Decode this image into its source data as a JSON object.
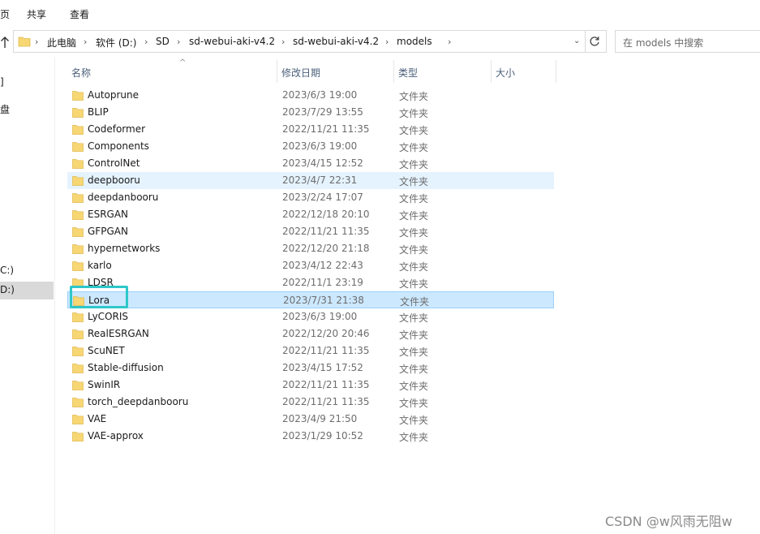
{
  "ribbon": {
    "tabs": [
      {
        "label": "页"
      },
      {
        "label": "共享"
      },
      {
        "label": "查看"
      }
    ]
  },
  "address": {
    "crumbs": [
      "此电脑",
      "软件 (D:)",
      "SD",
      "sd-webui-aki-v4.2",
      "sd-webui-aki-v4.2",
      "models"
    ],
    "search_placeholder": "在 models 中搜索"
  },
  "nav": {
    "items": [
      {
        "label": "]"
      },
      {
        "label": "盘"
      },
      {
        "label": "C:)"
      },
      {
        "label": "D:)"
      }
    ]
  },
  "columns": {
    "name": "名称",
    "date": "修改日期",
    "type": "类型",
    "size": "大小"
  },
  "files": [
    {
      "name": "Autoprune",
      "date": "2023/6/3 19:00",
      "type": "文件夹"
    },
    {
      "name": "BLIP",
      "date": "2023/7/29 13:55",
      "type": "文件夹"
    },
    {
      "name": "Codeformer",
      "date": "2022/11/21 11:35",
      "type": "文件夹"
    },
    {
      "name": "Components",
      "date": "2023/6/3 19:00",
      "type": "文件夹"
    },
    {
      "name": "ControlNet",
      "date": "2023/4/15 12:52",
      "type": "文件夹"
    },
    {
      "name": "deepbooru",
      "date": "2023/4/7 22:31",
      "type": "文件夹"
    },
    {
      "name": "deepdanbooru",
      "date": "2023/2/24 17:07",
      "type": "文件夹"
    },
    {
      "name": "ESRGAN",
      "date": "2022/12/18 20:10",
      "type": "文件夹"
    },
    {
      "name": "GFPGAN",
      "date": "2022/11/21 11:35",
      "type": "文件夹"
    },
    {
      "name": "hypernetworks",
      "date": "2022/12/20 21:18",
      "type": "文件夹"
    },
    {
      "name": "karlo",
      "date": "2023/4/12 22:43",
      "type": "文件夹"
    },
    {
      "name": "LDSR",
      "date": "2022/11/1 23:19",
      "type": "文件夹"
    },
    {
      "name": "Lora",
      "date": "2023/7/31 21:38",
      "type": "文件夹"
    },
    {
      "name": "LyCORIS",
      "date": "2023/6/3 19:00",
      "type": "文件夹"
    },
    {
      "name": "RealESRGAN",
      "date": "2022/12/20 20:46",
      "type": "文件夹"
    },
    {
      "name": "ScuNET",
      "date": "2022/11/21 11:35",
      "type": "文件夹"
    },
    {
      "name": "Stable-diffusion",
      "date": "2023/4/15 17:52",
      "type": "文件夹"
    },
    {
      "name": "SwinIR",
      "date": "2022/11/21 11:35",
      "type": "文件夹"
    },
    {
      "name": "torch_deepdanbooru",
      "date": "2022/11/21 11:35",
      "type": "文件夹"
    },
    {
      "name": "VAE",
      "date": "2023/4/9 21:50",
      "type": "文件夹"
    },
    {
      "name": "VAE-approx",
      "date": "2023/1/29 10:52",
      "type": "文件夹"
    }
  ],
  "watermark": "CSDN @w风雨无阻w",
  "colors": {
    "folder": "#f7d674",
    "hover_row": "#e5f3ff",
    "selected_row": "#cce8ff",
    "annotation_box": "#2ec7c9"
  }
}
